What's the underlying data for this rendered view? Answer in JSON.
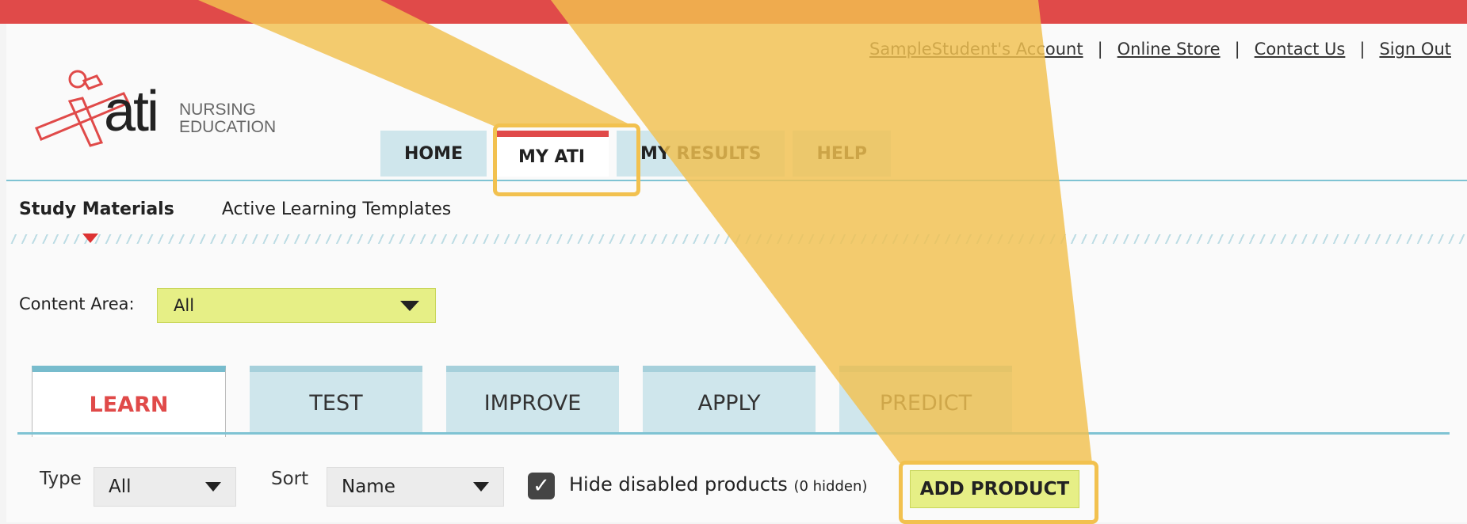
{
  "top_links": [
    "SampleStudent's Account",
    "Online Store",
    "Contact Us",
    "Sign Out"
  ],
  "link_separator": "|",
  "logo": {
    "name": "ati",
    "line1": "NURSING",
    "line2": "EDUCATION"
  },
  "nav": {
    "tabs": [
      "HOME",
      "MY ATI",
      "MY RESULTS",
      "HELP"
    ],
    "active": "MY ATI"
  },
  "subnav": {
    "items": [
      "Study Materials",
      "Active Learning Templates"
    ],
    "active": "Study Materials"
  },
  "content_area": {
    "label": "Content Area:",
    "value": "All"
  },
  "tabs": {
    "items": [
      "LEARN",
      "TEST",
      "IMPROVE",
      "APPLY",
      "PREDICT"
    ],
    "active": "LEARN"
  },
  "filters": {
    "type_label": "Type",
    "type_value": "All",
    "sort_label": "Sort",
    "sort_value": "Name",
    "hide_label": "Hide disabled products",
    "hide_count": "(0 hidden)",
    "hide_checked": true,
    "add_button": "ADD PRODUCT"
  },
  "colors": {
    "accent_red": "#e04a49",
    "highlight_yellow": "#f2c14f",
    "lime": "#e6ef86",
    "teal": "#7fc3d3"
  }
}
